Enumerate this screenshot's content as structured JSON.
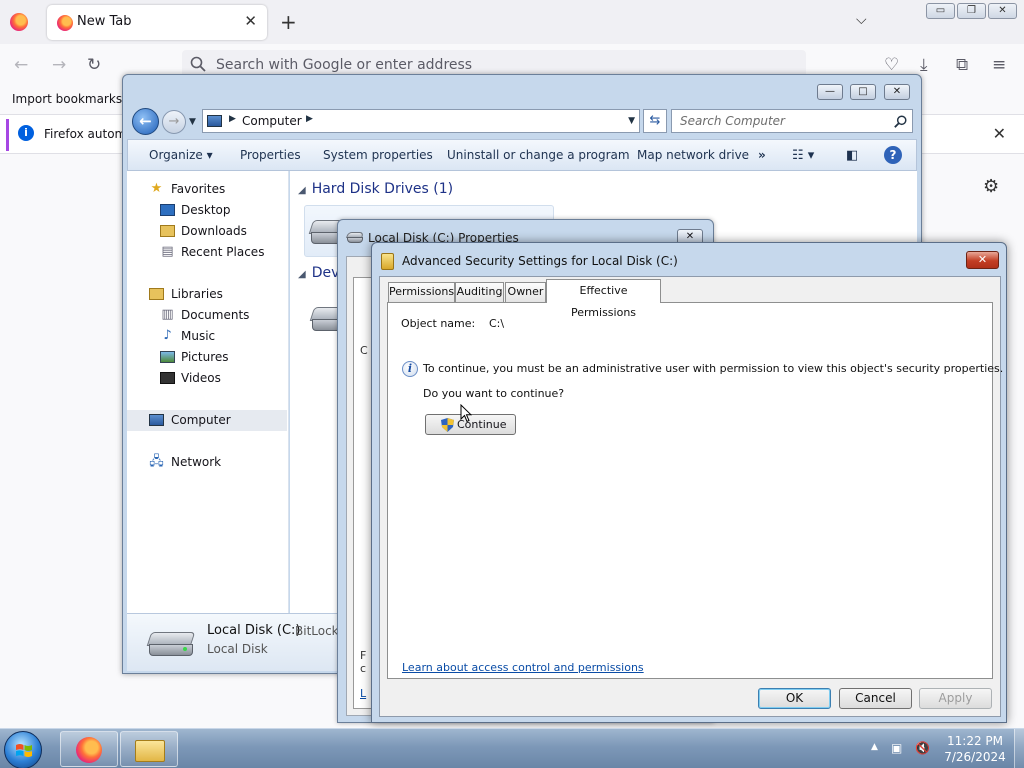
{
  "firefox": {
    "tab_title": "New Tab",
    "tab_close": "✕",
    "new_tab": "+",
    "tab_list": "⌵",
    "window_buttons": {
      "minimize": "▭",
      "restore": "❐",
      "close": "✕"
    },
    "url_placeholder": "Search with Google or enter address",
    "bookmark_item": "Import bookmarks…",
    "notification_text": "Firefox automa",
    "notification_close": "✕",
    "nav": {
      "back": "←",
      "forward": "→",
      "reload": "↻"
    },
    "toolbar": {
      "pocket": "♡",
      "download": "⤓",
      "extensions": "⧉",
      "menu": "≡"
    },
    "settings": "⚙"
  },
  "explorer": {
    "window_buttons": {
      "minimize": "—",
      "maximize": "□",
      "close": "✕"
    },
    "address_text": "Computer",
    "search_placeholder": "Search Computer",
    "commands": [
      "Organize",
      "Properties",
      "System properties",
      "Uninstall or change a program",
      "Map network drive"
    ],
    "organize_caret": "▾",
    "more_commands": "»",
    "help": "?",
    "nav_pane": {
      "favorites": "Favorites",
      "desktop": "Desktop",
      "downloads": "Downloads",
      "recent_places": "Recent Places",
      "libraries": "Libraries",
      "documents": "Documents",
      "music": "Music",
      "pictures": "Pictures",
      "videos": "Videos",
      "computer": "Computer",
      "network": "Network"
    },
    "groups": {
      "hard_disk_drives": "Hard Disk Drives (1)",
      "devices_partial": "Dev"
    },
    "details": {
      "name": "Local Disk (C:)",
      "bitlocker": "BitLocke",
      "type": "Local Disk"
    }
  },
  "properties_dialog": {
    "title": "Local Disk (C:) Properties",
    "close": "✕",
    "fragments": [
      "C",
      "F",
      "c",
      "L"
    ]
  },
  "adv_security": {
    "title": "Advanced Security Settings for Local Disk (C:)",
    "close": "✕",
    "tabs": [
      "Permissions",
      "Auditing",
      "Owner",
      "Effective Permissions"
    ],
    "object_name_label": "Object name:",
    "object_name_value": "C:\\",
    "message": "To continue, you must be an administrative user with permission to view this object's security properties.",
    "question": "Do you want to continue?",
    "continue_label": "Continue",
    "learn_link": "Learn about access control and permissions",
    "ok_label": "OK",
    "cancel_label": "Cancel",
    "apply_label": "Apply"
  },
  "taskbar": {
    "tray_arrow": "▲",
    "time": "11:22 PM",
    "date": "7/26/2024"
  }
}
